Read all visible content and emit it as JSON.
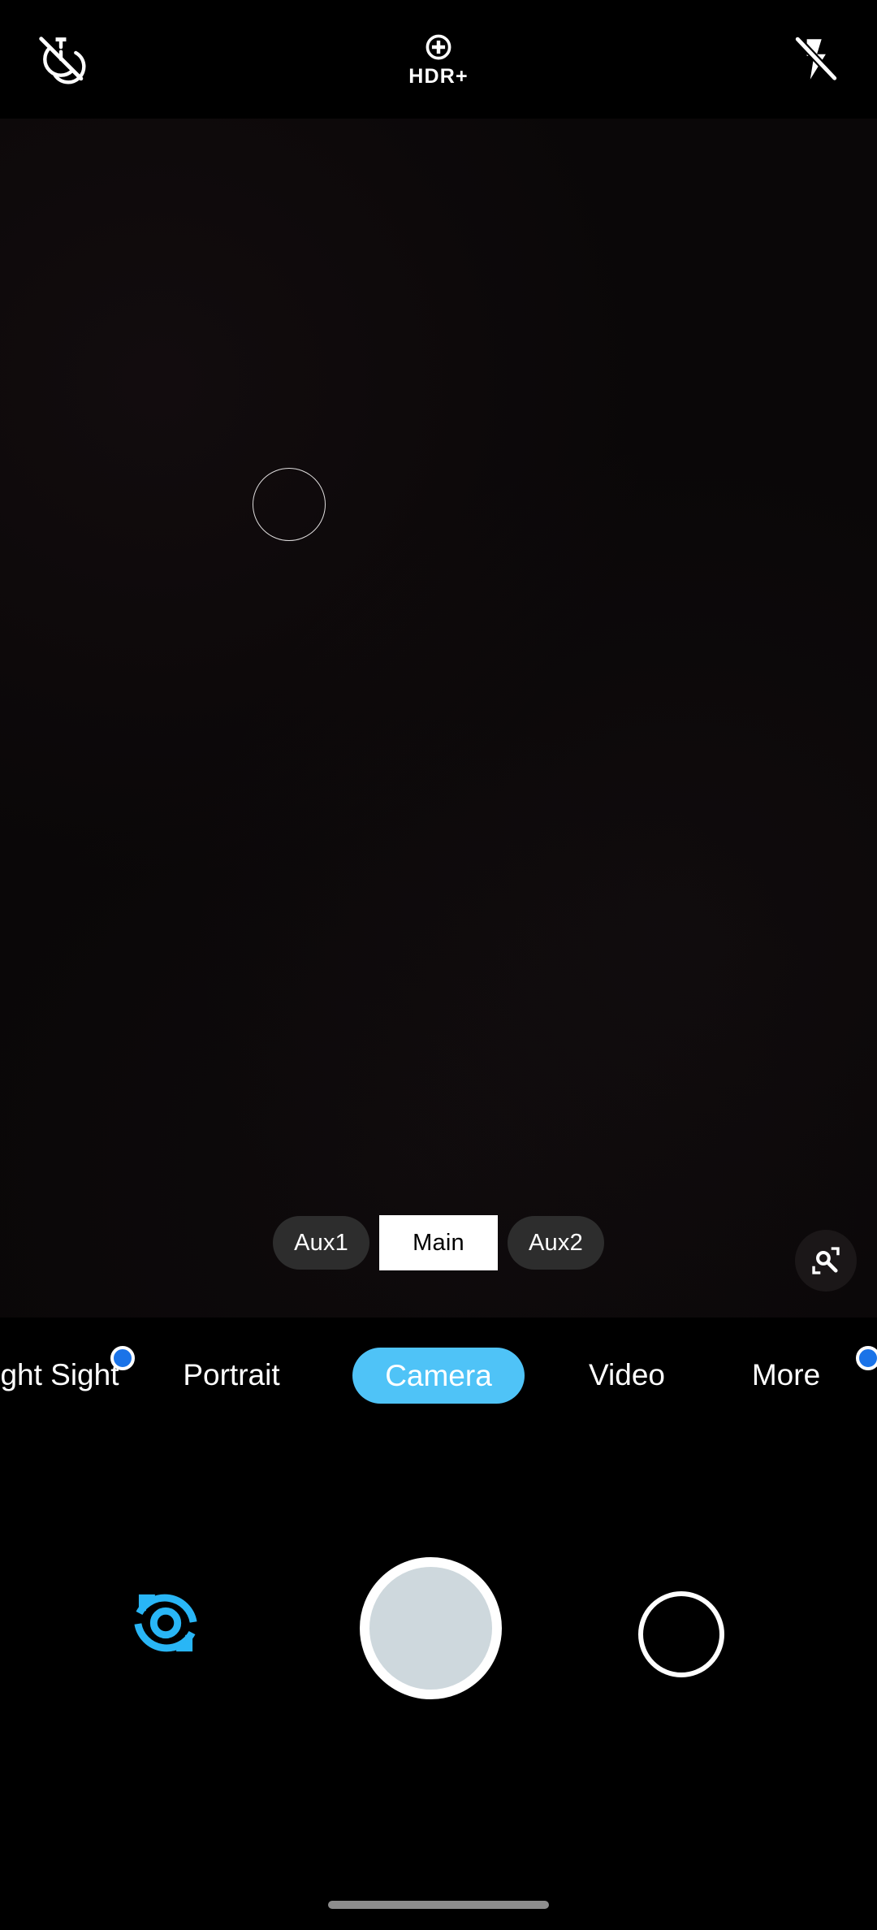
{
  "topbar": {
    "timer": {
      "icon": "timer-off-icon",
      "state": "off"
    },
    "hdr": {
      "icon": "hdr-plus-icon",
      "label": "HDR+"
    },
    "flash": {
      "icon": "flash-off-icon",
      "state": "off"
    }
  },
  "viewfinder": {
    "focus_ring": "focus-ring",
    "lens_chips": [
      {
        "label": "Aux1",
        "active": false
      },
      {
        "label": "Main",
        "active": true
      },
      {
        "label": "Aux2",
        "active": false
      }
    ],
    "lens_button": {
      "icon": "google-lens-icon"
    }
  },
  "modes": {
    "items": [
      {
        "label": "Night Sight",
        "selected": false,
        "badge": true
      },
      {
        "label": "Portrait",
        "selected": false,
        "badge": false
      },
      {
        "label": "Camera",
        "selected": true,
        "badge": false
      },
      {
        "label": "Video",
        "selected": false,
        "badge": false
      },
      {
        "label": "More",
        "selected": false,
        "badge": true
      }
    ]
  },
  "controls": {
    "flip": {
      "icon": "flip-camera-icon"
    },
    "shutter": {
      "icon": "shutter-button"
    },
    "gallery": {
      "icon": "gallery-thumbnail"
    }
  },
  "colors": {
    "accent_cyan": "#4fc3f7",
    "badge_blue": "#1a73e8",
    "shutter_fill": "#ced8dd",
    "chip_inactive": "#2d2d2d",
    "background": "#000000"
  }
}
